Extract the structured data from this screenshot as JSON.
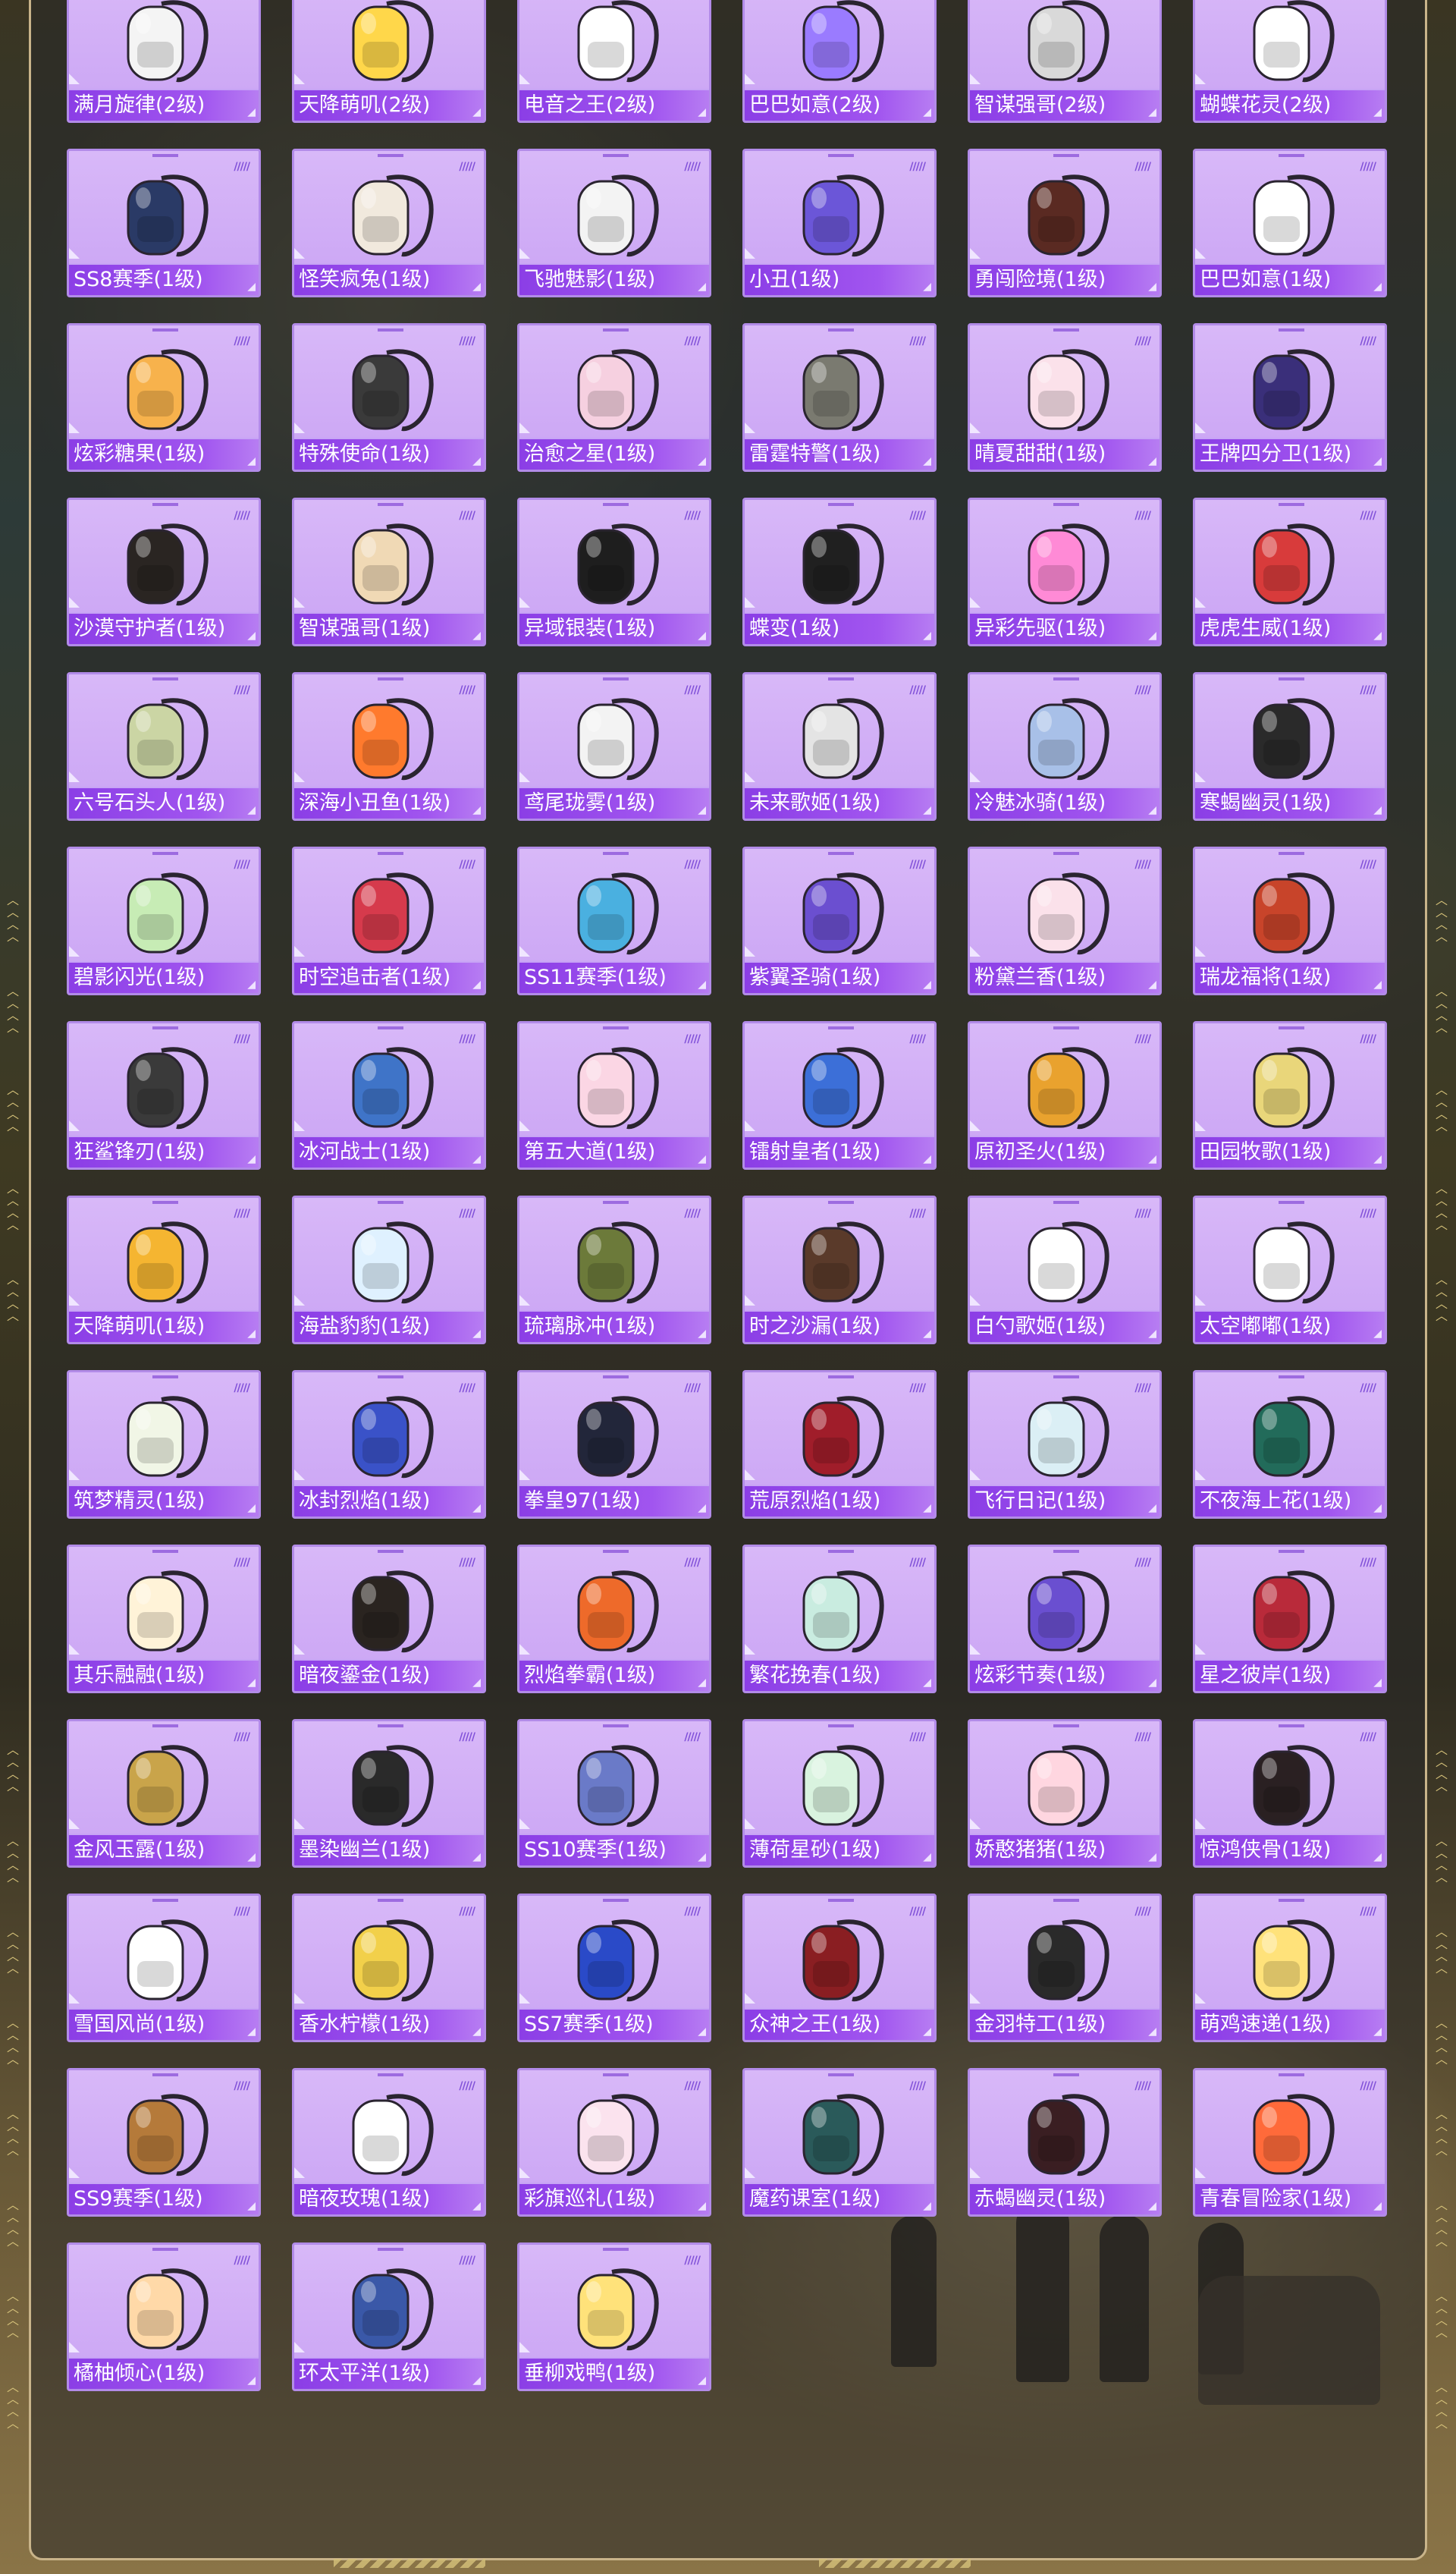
{
  "items": [
    {
      "name": "满月旋律(2级)"
    },
    {
      "name": "天降萌叽(2级)"
    },
    {
      "name": "电音之王(2级)"
    },
    {
      "name": "巴巴如意(2级)"
    },
    {
      "name": "智谋强哥(2级)"
    },
    {
      "name": "蝴蝶花灵(2级)"
    },
    {
      "name": "SS8赛季(1级)"
    },
    {
      "name": "怪笑疯兔(1级)"
    },
    {
      "name": "飞驰魅影(1级)"
    },
    {
      "name": "小丑(1级)"
    },
    {
      "name": "勇闯险境(1级)"
    },
    {
      "name": "巴巴如意(1级)"
    },
    {
      "name": "炫彩糖果(1级)"
    },
    {
      "name": "特殊使命(1级)"
    },
    {
      "name": "治愈之星(1级)"
    },
    {
      "name": "雷霆特警(1级)"
    },
    {
      "name": "晴夏甜甜(1级)"
    },
    {
      "name": "王牌四分卫(1级)"
    },
    {
      "name": "沙漠守护者(1级)"
    },
    {
      "name": "智谋强哥(1级)"
    },
    {
      "name": "异域银装(1级)"
    },
    {
      "name": "蝶变(1级)"
    },
    {
      "name": "异彩先驱(1级)"
    },
    {
      "name": "虎虎生威(1级)"
    },
    {
      "name": "六号石头人(1级)"
    },
    {
      "name": "深海小丑鱼(1级)"
    },
    {
      "name": "鸢尾珑雾(1级)"
    },
    {
      "name": "未来歌姬(1级)"
    },
    {
      "name": "冷魅冰骑(1级)"
    },
    {
      "name": "寒蝎幽灵(1级)"
    },
    {
      "name": "碧影闪光(1级)"
    },
    {
      "name": "时空追击者(1级)"
    },
    {
      "name": "SS11赛季(1级)"
    },
    {
      "name": "紫翼圣骑(1级)"
    },
    {
      "name": "粉黛兰香(1级)"
    },
    {
      "name": "瑞龙福将(1级)"
    },
    {
      "name": "狂鲨锋刃(1级)"
    },
    {
      "name": "冰河战士(1级)"
    },
    {
      "name": "第五大道(1级)"
    },
    {
      "name": "镭射皇者(1级)"
    },
    {
      "name": "原初圣火(1级)"
    },
    {
      "name": "田园牧歌(1级)"
    },
    {
      "name": "天降萌叽(1级)"
    },
    {
      "name": "海盐豹豹(1级)"
    },
    {
      "name": "琉璃脉冲(1级)"
    },
    {
      "name": "时之沙漏(1级)"
    },
    {
      "name": "白勺歌姬(1级)"
    },
    {
      "name": "太空嘟嘟(1级)"
    },
    {
      "name": "筑梦精灵(1级)"
    },
    {
      "name": "冰封烈焰(1级)"
    },
    {
      "name": "拳皇97(1级)"
    },
    {
      "name": "荒原烈焰(1级)"
    },
    {
      "name": "飞行日记(1级)"
    },
    {
      "name": "不夜海上花(1级)"
    },
    {
      "name": "其乐融融(1级)"
    },
    {
      "name": "暗夜鎏金(1级)"
    },
    {
      "name": "烈焰拳霸(1级)"
    },
    {
      "name": "繁花挽春(1级)"
    },
    {
      "name": "炫彩节奏(1级)"
    },
    {
      "name": "星之彼岸(1级)"
    },
    {
      "name": "金风玉露(1级)"
    },
    {
      "name": "墨染幽兰(1级)"
    },
    {
      "name": "SS10赛季(1级)"
    },
    {
      "name": "薄荷星砂(1级)"
    },
    {
      "name": "娇憨猪猪(1级)"
    },
    {
      "name": "惊鸿侠骨(1级)"
    },
    {
      "name": "雪国风尚(1级)"
    },
    {
      "name": "香水柠檬(1级)"
    },
    {
      "name": "SS7赛季(1级)"
    },
    {
      "name": "众神之王(1级)"
    },
    {
      "name": "金羽特工(1级)"
    },
    {
      "name": "萌鸡速递(1级)"
    },
    {
      "name": "SS9赛季(1级)"
    },
    {
      "name": "暗夜玫瑰(1级)"
    },
    {
      "name": "彩旗巡礼(1级)"
    },
    {
      "name": "魔药课室(1级)"
    },
    {
      "name": "赤蝎幽灵(1级)"
    },
    {
      "name": "青春冒险家(1级)"
    },
    {
      "name": "橘柚倾心(1级)"
    },
    {
      "name": "环太平洋(1级)"
    },
    {
      "name": "垂柳戏鸭(1级)"
    }
  ],
  "bag_colors": [
    "#f4f4f4",
    "#ffd74a",
    "#ffffff",
    "#9a7bff",
    "#d9d9d9",
    "#ffffff",
    "#2a3a66",
    "#f1e9dd",
    "#f3f3f3",
    "#6b56d8",
    "#5a2a22",
    "#ffffff",
    "#f7b24c",
    "#3a3a3a",
    "#f6d0e0",
    "#7a7a70",
    "#fbe1ea",
    "#3a2f7a",
    "#2a2522",
    "#f0d9b5",
    "#1e1e1e",
    "#202020",
    "#ff8ad6",
    "#d83b3b",
    "#cbd5a4",
    "#ff7a2d",
    "#f3f3f3",
    "#e4e4e4",
    "#a8c0e8",
    "#2a2a2a",
    "#c7ecb5",
    "#d63a4c",
    "#4ab0e0",
    "#6b4fd0",
    "#fbe1ea",
    "#c8442a",
    "#3a3a3a",
    "#3f74c8",
    "#fbd6e4",
    "#3c6fd8",
    "#e9a22e",
    "#e9d67a",
    "#f5b531",
    "#dff1ff",
    "#6c7a3a",
    "#5a3a2a",
    "#ffffff",
    "#ffffff",
    "#f1f6e6",
    "#3a52c8",
    "#22263a",
    "#a01d2a",
    "#dbeff5",
    "#226b5a",
    "#fff3d8",
    "#2a2420",
    "#ee6a2a",
    "#c9ece0",
    "#6a4fd0",
    "#b92a3a",
    "#c9a44a",
    "#2a2a2a",
    "#6a7ac8",
    "#d9f3df",
    "#ffd6e0",
    "#2a2022",
    "#ffffff",
    "#f2d04a",
    "#2a4ac8",
    "#8a1e22",
    "#2a2a2a",
    "#ffe27a",
    "#b57a3a",
    "#ffffff",
    "#fbe3ee",
    "#2a5a5a",
    "#3a1e22",
    "#ff6a3a",
    "#ffd9a8",
    "#3a58a8",
    "#ffe27a"
  ]
}
